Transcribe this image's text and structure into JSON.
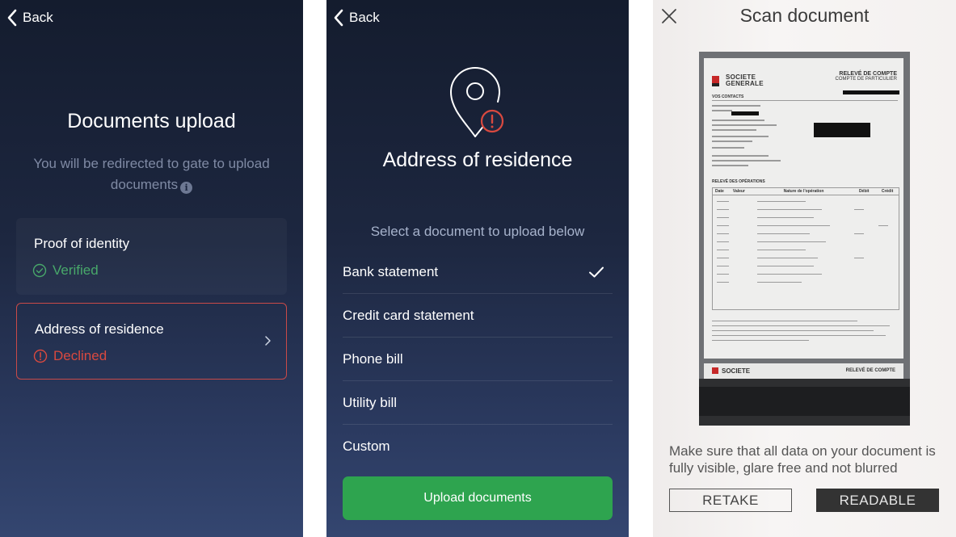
{
  "colors": {
    "accent_green": "#2ea44f",
    "verified": "#48a86a",
    "declined": "#d9493f"
  },
  "screen1": {
    "back_label": "Back",
    "title": "Documents upload",
    "subtitle": "You will be redirected to gate to upload documents",
    "info_icon": "info-icon",
    "cards": [
      {
        "label": "Proof of identity",
        "status": "Verified",
        "status_icon": "check-circle-icon"
      },
      {
        "label": "Address of residence",
        "status": "Declined",
        "status_icon": "alert-circle-icon"
      }
    ]
  },
  "screen2": {
    "back_label": "Back",
    "icon": "location-pin-alert-icon",
    "title": "Address of residence",
    "subtitle": "Select a document to upload below",
    "options": [
      {
        "label": "Bank statement",
        "selected": true
      },
      {
        "label": "Credit card statement",
        "selected": false
      },
      {
        "label": "Phone bill",
        "selected": false
      },
      {
        "label": "Utility bill",
        "selected": false
      },
      {
        "label": "Custom",
        "selected": false
      }
    ],
    "upload_label": "Upload documents"
  },
  "screen3": {
    "title": "Scan document",
    "close_icon": "close-icon",
    "document": {
      "brand_line1": "SOCIETE",
      "brand_line2": "GENERALE",
      "heading": "RELEVÉ DE COMPTE",
      "subheading": "COMPTE DE PARTICULIER",
      "section_contacts": "VOS CONTACTS",
      "section_ops": "RELEVÉ DES OPÉRATIONS",
      "col_date": "Date",
      "col_valeur": "Valeur",
      "col_nature": "Nature de l'opération",
      "col_debit": "Débit",
      "col_credit": "Crédit",
      "next_brand": "SOCIETE",
      "next_heading": "RELEVÉ DE COMPTE"
    },
    "message": "Make sure that all data on your document is fully visible, glare free and not blurred",
    "retake_label": "RETAKE",
    "readable_label": "READABLE"
  }
}
